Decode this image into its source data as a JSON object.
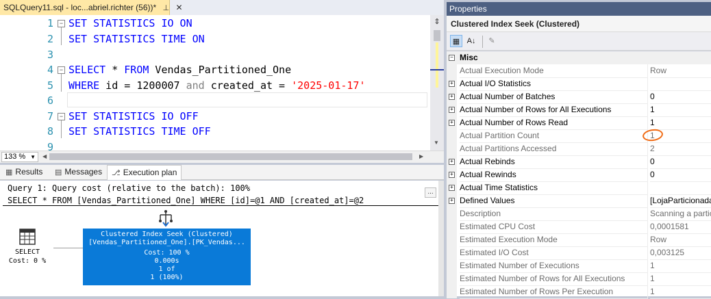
{
  "editor_tab": {
    "title": "SQLQuery11.sql - loc...abriel.richter (56))*",
    "pin_glyph": "⊥",
    "close_glyph": "✕"
  },
  "editor": {
    "line_numbers": [
      "1",
      "2",
      "3",
      "4",
      "5",
      "6",
      "7",
      "8",
      "9"
    ],
    "lines": {
      "l1": {
        "kw": "SET STATISTICS IO ON"
      },
      "l2": {
        "kw": "SET STATISTICS TIME ON"
      },
      "l4": {
        "kw": "SELECT",
        "mid": " * ",
        "kw2": "FROM",
        "rest": " Vendas_Partitioned_One"
      },
      "l5": {
        "kw": "WHERE",
        "a": " id = 1200007 ",
        "op": "and",
        "b": " created_at = ",
        "str": "'2025-01-17'"
      },
      "l7": {
        "kw": "SET STATISTICS IO OFF"
      },
      "l8": {
        "kw": "SET STATISTICS TIME OFF"
      }
    },
    "zoom": "133 %"
  },
  "results_tabs": [
    {
      "label": "Results",
      "icon": "grid-icon"
    },
    {
      "label": "Messages",
      "icon": "messages-icon"
    },
    {
      "label": "Execution plan",
      "icon": "execution-plan-icon"
    }
  ],
  "plan": {
    "query_header": "Query 1: Query cost (relative to the batch): 100%",
    "query_text": "SELECT * FROM [Vendas_Partitioned_One] WHERE [id]=@1 AND [created_at]=@2",
    "more_button": "...",
    "select_node": {
      "label": "SELECT",
      "cost": "Cost: 0 %"
    },
    "seek_node": {
      "title": "Clustered Index Seek (Clustered)",
      "object": "[Vendas_Partitioned_One].[PK_Vendas...",
      "cost": "Cost: 100 %",
      "time": "0.000s",
      "rows": "1 of",
      "estimate": "1 (100%)"
    }
  },
  "properties": {
    "title": "Properties",
    "object": "Clustered Index Seek (Clustered)",
    "category": "Misc",
    "rows": [
      {
        "name": "Actual Execution Mode",
        "value": "Row",
        "expand": false,
        "readonly": true
      },
      {
        "name": "Actual I/O Statistics",
        "value": "",
        "expand": true,
        "readonly": false
      },
      {
        "name": "Actual Number of Batches",
        "value": "0",
        "expand": true,
        "readonly": false
      },
      {
        "name": "Actual Number of Rows for All Executions",
        "value": "1",
        "expand": true,
        "readonly": false
      },
      {
        "name": "Actual Number of Rows Read",
        "value": "1",
        "expand": true,
        "readonly": false
      },
      {
        "name": "Actual Partition Count",
        "value": "1",
        "expand": false,
        "readonly": true
      },
      {
        "name": "Actual Partitions Accessed",
        "value": "2",
        "expand": false,
        "readonly": true
      },
      {
        "name": "Actual Rebinds",
        "value": "0",
        "expand": true,
        "readonly": false
      },
      {
        "name": "Actual Rewinds",
        "value": "0",
        "expand": true,
        "readonly": false
      },
      {
        "name": "Actual Time Statistics",
        "value": "",
        "expand": true,
        "readonly": false
      },
      {
        "name": "Defined Values",
        "value": "[LojaParticionada",
        "expand": true,
        "readonly": false
      },
      {
        "name": "Description",
        "value": "Scanning a partic",
        "expand": false,
        "readonly": true
      },
      {
        "name": "Estimated CPU Cost",
        "value": "0,0001581",
        "expand": false,
        "readonly": true
      },
      {
        "name": "Estimated Execution Mode",
        "value": "Row",
        "expand": false,
        "readonly": true
      },
      {
        "name": "Estimated I/O Cost",
        "value": "0,003125",
        "expand": false,
        "readonly": true
      },
      {
        "name": "Estimated Number of Executions",
        "value": "1",
        "expand": false,
        "readonly": true
      },
      {
        "name": "Estimated Number of Rows for All Executions",
        "value": "1",
        "expand": false,
        "readonly": true
      },
      {
        "name": "Estimated Number of Rows Per Execution",
        "value": "1",
        "expand": false,
        "readonly": true
      }
    ]
  },
  "colors": {
    "keyword": "#0000ff",
    "string": "#ff0000",
    "operator": "#808080",
    "line_number": "#2b91af",
    "tab_active": "#ffe8a6",
    "plan_node": "#0a7ad8",
    "annotation": "#f06a13"
  }
}
